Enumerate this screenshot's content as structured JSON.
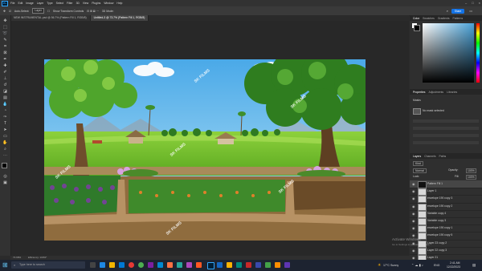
{
  "menu": {
    "items": [
      "File",
      "Edit",
      "Image",
      "Layer",
      "Type",
      "Select",
      "Filter",
      "3D",
      "View",
      "Plugins",
      "Window",
      "Help"
    ],
    "window_controls": [
      "–",
      "□",
      "×"
    ]
  },
  "options": {
    "auto_select": "Auto-Select:",
    "auto_select_value": "Layer",
    "show_transform": "Show Transform Controls",
    "share": "Share"
  },
  "tabs": [
    {
      "label": "NEW INSTRUMENTAL.psd @ 56.7% (Pattern Fill 1, RGB/8)"
    },
    {
      "label": "Untitled-3 @ 73.7% (Pattern Fill 1, RGB/8)"
    }
  ],
  "status": {
    "zoom": "73.68%",
    "doc": "Efficiency: 100%*"
  },
  "right_panel": {
    "color_tabs": [
      "Color",
      "Swatches",
      "Gradients",
      "Patterns"
    ],
    "properties_tabs": [
      "Properties",
      "Adjustments",
      "Libraries"
    ],
    "properties_title": "Masks",
    "properties_item": "No mask selected",
    "layers_tabs": [
      "Layers",
      "Channels",
      "Paths"
    ],
    "kind": "Kind",
    "blend_mode": "Normal",
    "opacity_label": "Opacity:",
    "opacity_value": "100%",
    "lock_label": "Lock:",
    "fill_label": "Fill:",
    "fill_value": "100%",
    "layers": [
      "Pattern Fill 1",
      "Layer 1",
      "envelope 190 copy 3",
      "envelope 190 copy 2",
      "Variable copy 4",
      "Variable copy 3",
      "envelope 190 copy 1",
      "envelope 190 copy 5",
      "Layer 23 copy 2",
      "Layer 22 copy 3",
      "Layer 21"
    ]
  },
  "activation": {
    "line1": "Activate Windows",
    "line2": "Go to Settings to activate Windows."
  },
  "taskbar": {
    "weather": "17°C  Sunny",
    "lang": "ENG",
    "time": "2:41 AM",
    "date": "12/22/2023",
    "search": "Type here to search"
  },
  "artwork": {
    "watermark": "SK FILMS"
  },
  "colors": {
    "accent": "#1473e6",
    "ui_dark": "#2b2b2b",
    "panel": "#2f2f2f"
  }
}
